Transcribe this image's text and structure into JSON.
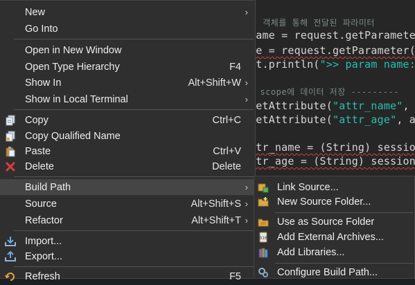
{
  "editor": {
    "lines": [
      {
        "text": "ㄷ 객체를 통해 전달된 파라미터",
        "kind": "comment"
      },
      {
        "pre": "name = request.getParameter",
        "squig": "",
        "str": "",
        "post": "",
        "kind": "code"
      },
      {
        "pre": "ge = request.getParameter(",
        "kind": "code2"
      },
      {
        "pre": "ut.println(",
        "str": "\">> param name:",
        "kind": "code3"
      },
      {
        "text": "n scope에 데이터 저장 ---------",
        "kind": "comment"
      },
      {
        "pre": "setAttribute(",
        "str": "\"attr_name\"",
        "post": ",",
        "kind": "code4"
      },
      {
        "pre": "setAttribute(",
        "str": "\"attr_age\"",
        "post": ", a",
        "kind": "code5"
      },
      {
        "pre": "ttr_name = (String) sessio",
        "kind": "code6"
      },
      {
        "pre": "ttr_age = (String) session",
        "kind": "code7"
      }
    ]
  },
  "context_menu": {
    "items": [
      {
        "label": "New",
        "accel": "",
        "submenu": true,
        "icon": ""
      },
      {
        "label": "Go Into",
        "accel": "",
        "submenu": false,
        "icon": ""
      },
      {
        "label": "Open in New Window",
        "accel": "",
        "submenu": false,
        "icon": ""
      },
      {
        "label": "Open Type Hierarchy",
        "accel": "F4",
        "submenu": false,
        "icon": ""
      },
      {
        "label": "Show In",
        "accel": "Alt+Shift+W",
        "submenu": true,
        "icon": ""
      },
      {
        "label": "Show in Local Terminal",
        "accel": "",
        "submenu": true,
        "icon": ""
      },
      {
        "label": "Copy",
        "accel": "Ctrl+C",
        "submenu": false,
        "icon": "copy-icon"
      },
      {
        "label": "Copy Qualified Name",
        "accel": "",
        "submenu": false,
        "icon": "copy-qualified-name-icon"
      },
      {
        "label": "Paste",
        "accel": "Ctrl+V",
        "submenu": false,
        "icon": "paste-icon"
      },
      {
        "label": "Delete",
        "accel": "Delete",
        "submenu": false,
        "icon": "delete-icon"
      },
      {
        "label": "Build Path",
        "accel": "",
        "submenu": true,
        "icon": "",
        "highlighted": true
      },
      {
        "label": "Source",
        "accel": "Alt+Shift+S",
        "submenu": true,
        "icon": ""
      },
      {
        "label": "Refactor",
        "accel": "Alt+Shift+T",
        "submenu": true,
        "icon": ""
      },
      {
        "label": "Import...",
        "accel": "",
        "submenu": false,
        "icon": "import-icon"
      },
      {
        "label": "Export...",
        "accel": "",
        "submenu": false,
        "icon": "export-icon"
      },
      {
        "label": "Refresh",
        "accel": "F5",
        "submenu": false,
        "icon": "refresh-icon"
      }
    ]
  },
  "build_path_submenu": {
    "items": [
      {
        "label": "Link Source...",
        "icon": "link-source-icon"
      },
      {
        "label": "New Source Folder...",
        "icon": "new-source-folder-icon"
      },
      {
        "label": "Use as Source Folder",
        "icon": "use-as-source-folder-icon"
      },
      {
        "label": "Add External Archives...",
        "icon": "add-external-archives-icon"
      },
      {
        "label": "Add Libraries...",
        "icon": "add-libraries-icon"
      },
      {
        "label": "Configure Build Path...",
        "icon": "configure-build-path-icon"
      }
    ]
  },
  "colors": {
    "menu_bg": "#2f2f2f",
    "menu_highlight": "#454545",
    "delete_red": "#e03c3c",
    "string_teal": "#27c0b0"
  }
}
